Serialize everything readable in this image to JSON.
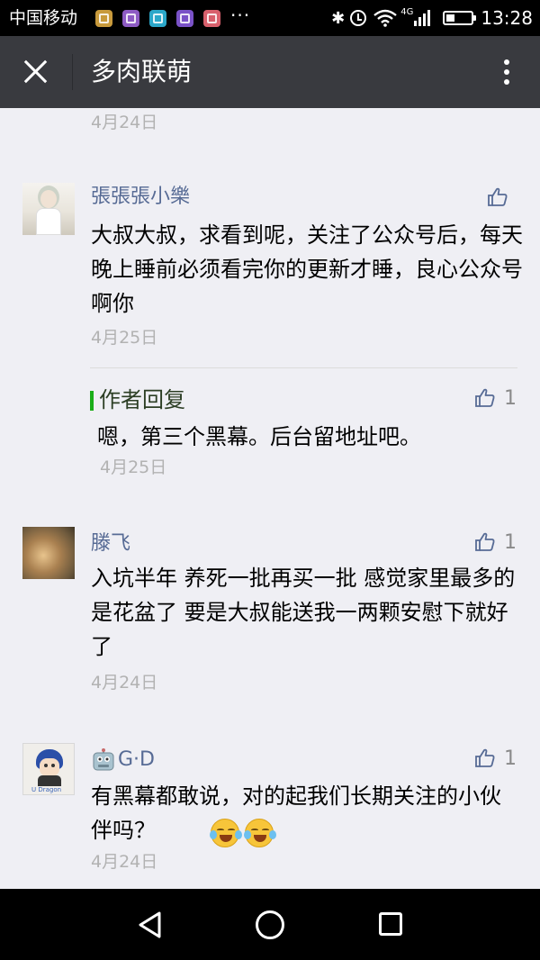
{
  "status_bar": {
    "carrier": "中国移动",
    "more": "···",
    "network": "4G",
    "time": "13:28",
    "notification_colors": [
      "#c89a3c",
      "#8e5bc4",
      "#2ba7c9",
      "#7a52c7",
      "#d8606c"
    ]
  },
  "header": {
    "title": "多肉联萌"
  },
  "feed": {
    "top_date": "4月24日",
    "comments": [
      {
        "name": "張張張小樂",
        "text": "大叔大叔，求看到呢，关注了公众号后，每天晚上睡前必须看完你的更新才睡，良心公众号啊你",
        "date": "4月25日",
        "likes": "",
        "reply": {
          "label": "作者回复",
          "text": "嗯，第三个黑幕。后台留地址吧。",
          "date": "4月25日",
          "likes": "1"
        }
      },
      {
        "name": "滕飞",
        "text": "入坑半年 养死一批再买一批  感觉家里最多的是花盆了 要是大叔能送我一两颗安慰下就好了",
        "date": "4月24日",
        "likes": "1"
      },
      {
        "name": "G·D",
        "text": "有黑幕都敢说，对的起我们长期关注的小伙伴吗？",
        "date": "4月24日",
        "likes": "1",
        "avatar_tag": "U Dragon"
      }
    ]
  },
  "bottom_nav": {
    "back": "back",
    "home": "home",
    "recent": "recent"
  },
  "colors": {
    "accent_name": "#576b95",
    "reply_bar": "#1aad19",
    "date_gray": "#b2b2b2",
    "nav_bar": "#393a3f"
  }
}
